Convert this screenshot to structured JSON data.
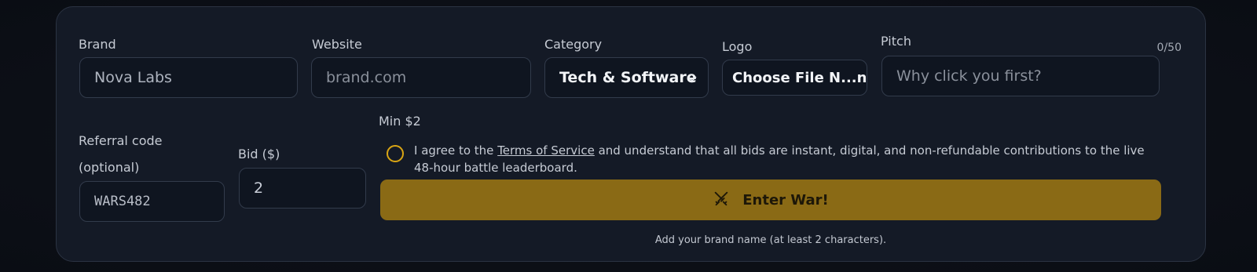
{
  "form": {
    "brand": {
      "label": "Brand",
      "value": "Nova Labs"
    },
    "website": {
      "label": "Website",
      "placeholder": "brand.com"
    },
    "category": {
      "label": "Category",
      "value": "Tech & Software"
    },
    "logo": {
      "label": "Logo",
      "button": "Choose File N...n"
    },
    "pitch": {
      "label": "Pitch",
      "placeholder": "Why click you first?",
      "counter": "0/50"
    },
    "referral": {
      "label_line1": "Referral code",
      "label_line2": "(optional)",
      "value": "WARS482"
    },
    "bid": {
      "label": "Bid ($)",
      "value": "2",
      "min": "Min $2"
    },
    "agree": {
      "prefix": "I agree to the ",
      "link": "Terms of Service",
      "suffix": " and understand that all bids are instant, digital, and non-refundable contributions to the live 48-hour battle leaderboard."
    },
    "submit": {
      "label": "Enter War!",
      "icon": "crossed-swords-icon"
    },
    "hint": "Add your brand name (at least 2 characters)."
  },
  "colors": {
    "panel": "#141a26",
    "accent": "#d9a514",
    "button": "#8a6a15"
  }
}
